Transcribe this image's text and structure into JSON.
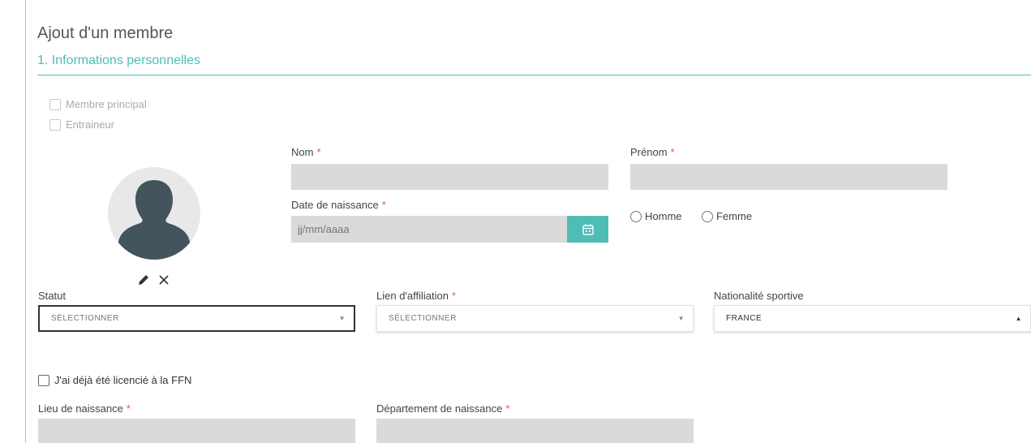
{
  "page": {
    "title": "Ajout d'un membre",
    "section_title": "1. Informations personnelles"
  },
  "checkboxes": {
    "membre_principal": "Membre principal",
    "entraineur": "Entraineur",
    "deja_licencie": "J'ai déjà été licencié à la FFN"
  },
  "avatar": {
    "edit_icon": "pencil-icon",
    "remove_icon": "close-icon"
  },
  "fields": {
    "nom": {
      "label": "Nom",
      "required": "*",
      "value": ""
    },
    "prenom": {
      "label": "Prénom",
      "required": "*",
      "value": ""
    },
    "date_naissance": {
      "label": "Date de naissance",
      "required": "*",
      "placeholder": "jj/mm/aaaa",
      "calendar_icon": "calendar-icon"
    },
    "lieu_naissance": {
      "label": "Lieu de naissance",
      "required": "*",
      "value": ""
    },
    "departement_naissance": {
      "label": "Département de naissance",
      "required": "*",
      "value": ""
    }
  },
  "gender": {
    "homme": "Homme",
    "femme": "Femme"
  },
  "selects": {
    "statut": {
      "label": "Statut",
      "value": "SÉLECTIONNER",
      "caret": "▼"
    },
    "lien_affiliation": {
      "label": "Lien d'affiliation",
      "required": "*",
      "value": "SÉLECTIONNER",
      "caret": "▼"
    },
    "nationalite_sportive": {
      "label": "Nationalité sportive",
      "value": "FRANCE",
      "caret": "▲"
    }
  },
  "colors": {
    "accent": "#4dbdb6",
    "required": "#e05a5a",
    "input_bg": "#dadada"
  }
}
